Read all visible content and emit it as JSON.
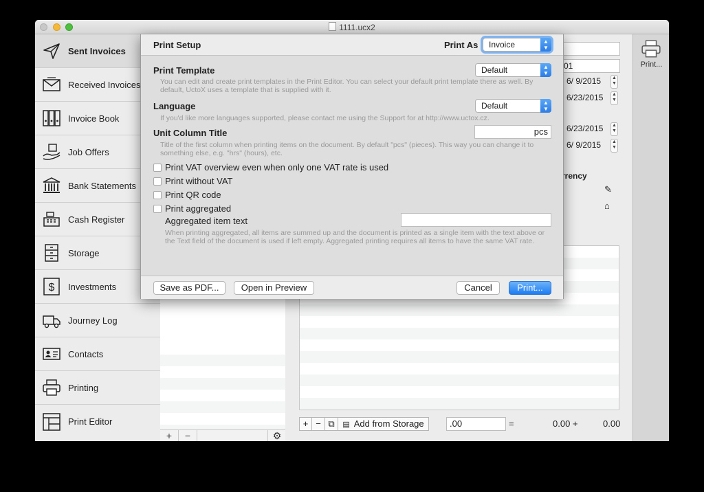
{
  "window": {
    "title": "1111.ucx2"
  },
  "sidebar": {
    "items": [
      {
        "label": "Sent Invoices",
        "icon": "paper-plane-icon"
      },
      {
        "label": "Received Invoices",
        "icon": "envelope-icon"
      },
      {
        "label": "Invoice Book",
        "icon": "binders-icon"
      },
      {
        "label": "Job Offers",
        "icon": "hand-offer-icon"
      },
      {
        "label": "Bank Statements",
        "icon": "bank-icon"
      },
      {
        "label": "Cash Register",
        "icon": "cash-register-icon"
      },
      {
        "label": "Storage",
        "icon": "cabinet-icon"
      },
      {
        "label": "Investments",
        "icon": "dollar-icon"
      },
      {
        "label": "Journey Log",
        "icon": "truck-icon"
      },
      {
        "label": "Contacts",
        "icon": "contact-card-icon"
      },
      {
        "label": "Printing",
        "icon": "printer-icon"
      },
      {
        "label": "Print Editor",
        "icon": "layout-icon"
      }
    ]
  },
  "list_bottom": {
    "add": "+",
    "remove": "−",
    "gear": "⚙"
  },
  "main": {
    "partial_number": "01",
    "dates": [
      "6/ 9/2015",
      "6/23/2015",
      "6/23/2015",
      "6/ 9/2015"
    ],
    "currency_label": "rrency",
    "bottom": {
      "add_from_storage": "Add from Storage",
      "amount_value": ".00",
      "equals": "=",
      "total_1": "0.00 +",
      "total_2": "0.00"
    }
  },
  "right_toolbar": {
    "print_label": "Print..."
  },
  "dialog": {
    "title": "Print Setup",
    "print_as_label": "Print As",
    "print_as_value": "Invoice",
    "template": {
      "title": "Print Template",
      "value": "Default",
      "hint": "You can edit and create print templates in the Print Editor. You can select your default print template there as well. By default, UctoX uses a template that is supplied with it."
    },
    "language": {
      "title": "Language",
      "value": "Default",
      "hint": "If you'd like more languages supported, please contact me using the Support for at http://www.uctox.cz."
    },
    "unit": {
      "title": "Unit Column Title",
      "value": "pcs",
      "hint": "Title of the first column when printing items on the document. By default \"pcs\" (pieces). This way you can change it to something else, e.g. \"hrs\" (hours), etc."
    },
    "checkboxes": [
      "Print VAT overview even when only one VAT rate is used",
      "Print without VAT",
      "Print QR code",
      "Print aggregated"
    ],
    "aggregated": {
      "label": "Aggregated item text",
      "value": "",
      "hint": "When printing aggregated, all items are summed up and the document is printed as a single item with the text above or the Text field of the document is used if left empty. Aggregated printing requires all items to have the same VAT rate."
    },
    "buttons": {
      "save_pdf": "Save as PDF...",
      "open_preview": "Open in Preview",
      "cancel": "Cancel",
      "print": "Print..."
    }
  }
}
